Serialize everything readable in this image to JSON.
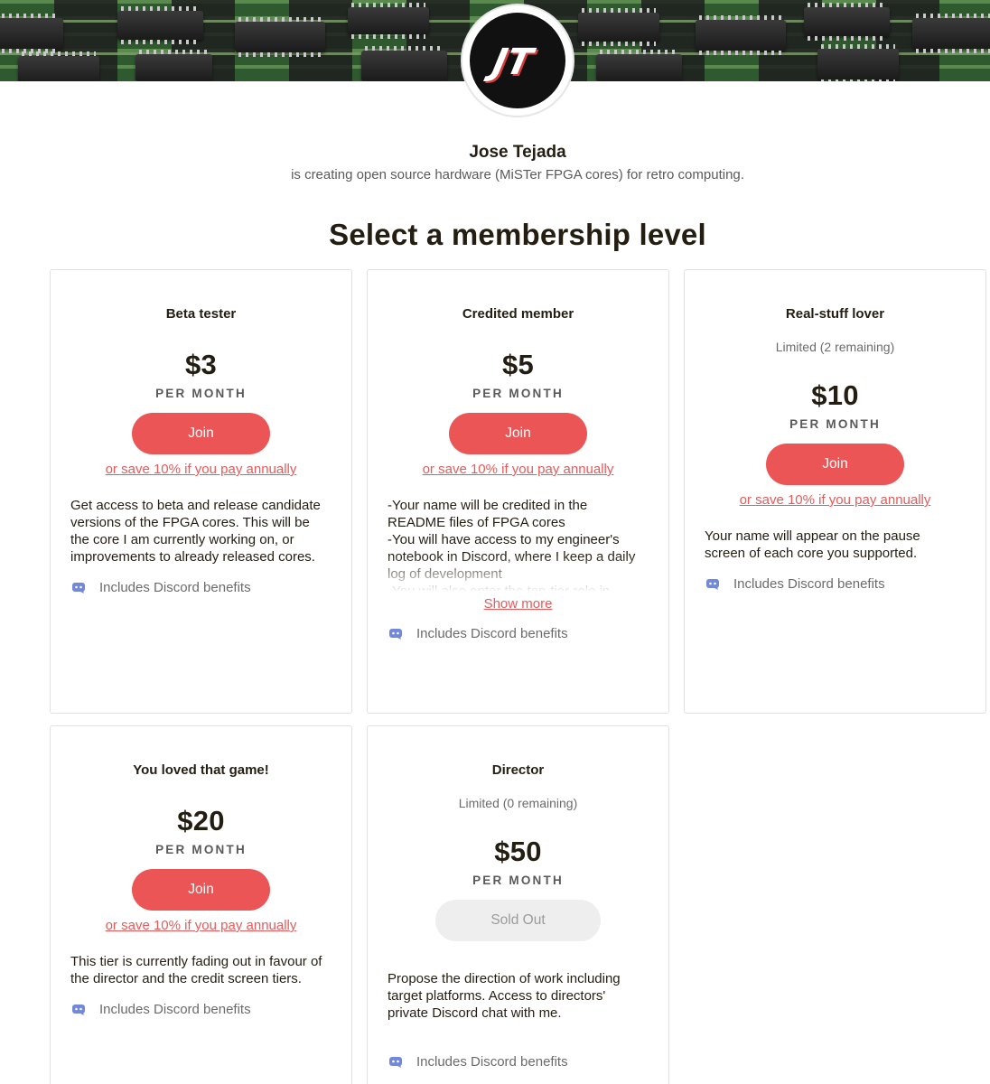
{
  "creator": {
    "avatar_initials": "JT",
    "name": "Jose Tejada",
    "tagline": "is creating open source hardware (MiSTer FPGA cores) for retro computing."
  },
  "section_title": "Select a membership level",
  "tiers": [
    {
      "title": "Beta tester",
      "limit": "",
      "price": "$3",
      "period": "PER MONTH",
      "button": "Join",
      "annual": "or save 10% if you pay annually",
      "description": [
        "Get access to beta and release candidate",
        "versions of the FPGA cores. This will be",
        "the core I am currently working on, or",
        "improvements to already released cores."
      ],
      "discord": "Includes Discord benefits"
    },
    {
      "title": "Credited member",
      "limit": "",
      "price": "$5",
      "period": "PER MONTH",
      "button": "Join",
      "annual": "or save 10% if you pay annually",
      "description": [
        "-Your name will be credited in the",
        "README files of FPGA cores",
        "-You will have access to my engineer's",
        "notebook in Discord, where I keep a daily",
        "log of development",
        "-You will also enter the top-tier role in"
      ],
      "show_more": "Show more",
      "discord": "Includes Discord benefits"
    },
    {
      "title": "Real-stuff lover",
      "limit": "Limited (2 remaining)",
      "price": "$10",
      "period": "PER MONTH",
      "button": "Join",
      "annual": "or save 10% if you pay annually",
      "description": [
        "Your name will appear on the pause",
        "screen of each core you supported."
      ],
      "discord": "Includes Discord benefits"
    },
    {
      "title": "You loved that game!",
      "limit": "",
      "price": "$20",
      "period": "PER MONTH",
      "button": "Join",
      "annual": "or save 10% if you pay annually",
      "description": [
        "This tier is currently fading out in favour of",
        "the director and the credit screen tiers."
      ],
      "discord": "Includes Discord benefits"
    },
    {
      "title": "Director",
      "limit": "Limited (0 remaining)",
      "price": "$50",
      "period": "PER MONTH",
      "button": "Sold Out",
      "description": [
        "Propose the direction of work including",
        "target platforms. Access to directors'",
        "private Discord chat with me."
      ],
      "discord": "Includes Discord benefits"
    }
  ],
  "colors": {
    "accent": "#ec5555",
    "link": "#e85a5a",
    "discord_icon": "#7289da",
    "sold_out_bg": "#eeeeee"
  }
}
